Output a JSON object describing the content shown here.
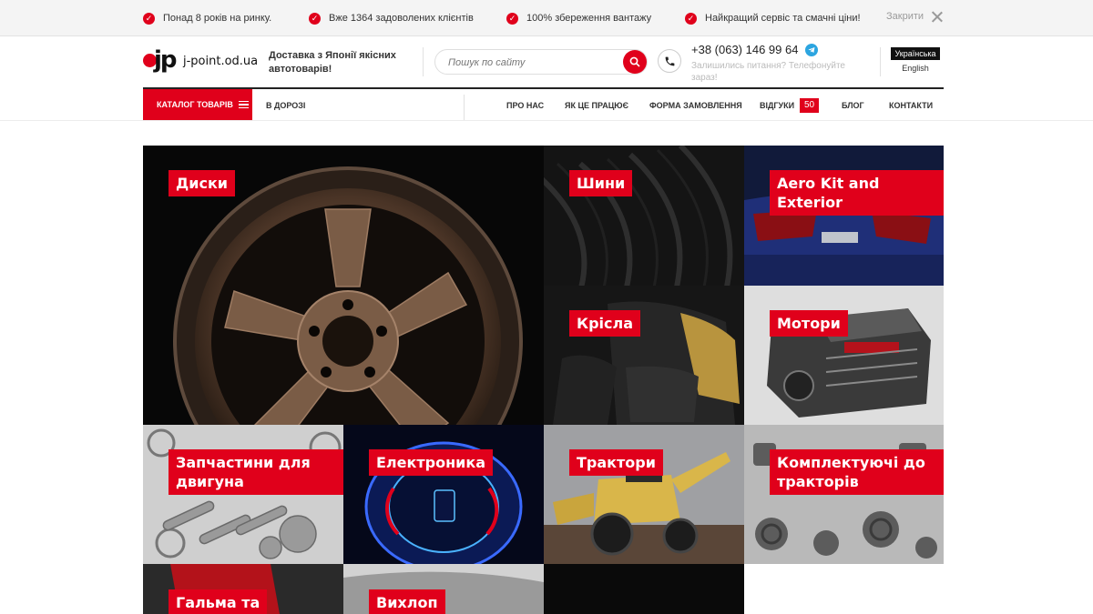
{
  "topbar": {
    "items": [
      {
        "text": "Понад 8 років на ринку."
      },
      {
        "text": "Вже 1364 задоволених клієнтів"
      },
      {
        "text": "100% збереження вантажу"
      },
      {
        "text": "Найкращий сервіс та смачні ціни!"
      }
    ],
    "close_label": "Закрити"
  },
  "header": {
    "logo_letters": "jp",
    "logo_text": "j-point.od.ua",
    "tagline": "Доставка з Японії якісних автотоварів!",
    "search_placeholder": "Пошук по сайту",
    "phone": "+38 (063) 146 99 64",
    "phone_sub": "Залишились питання? Телефонуйте зараз!",
    "lang_active": "Українська",
    "lang_other": "English"
  },
  "nav": {
    "catalog_label": "КАТАЛОГ ТОВАРІВ",
    "on_the_way": "В ДОРОЗІ",
    "links": [
      {
        "label": "ПРО НАС"
      },
      {
        "label": "ЯК ЦЕ ПРАЦЮЄ"
      },
      {
        "label": "ФОРМА ЗАМОВЛЕННЯ"
      },
      {
        "label": "ВІДГУКИ"
      },
      {
        "label": "БЛОГ"
      },
      {
        "label": "КОНТАКТИ"
      }
    ],
    "reviews_count": "50"
  },
  "categories": [
    {
      "label": "Диски"
    },
    {
      "label": "Шини"
    },
    {
      "label": "Aero Kit and Exterior"
    },
    {
      "label": "Крісла"
    },
    {
      "label": "Мотори"
    },
    {
      "label": "Запчастини для двигуна"
    },
    {
      "label": "Електроника"
    },
    {
      "label": "Трактори"
    },
    {
      "label": "Комплектуючі до тракторів"
    },
    {
      "label": "Гальма та"
    },
    {
      "label": "Вихлоп"
    }
  ],
  "colors": {
    "accent": "#e0001b",
    "nav_border": "#222222",
    "telegram": "#2ca5e0"
  },
  "icons": [
    "check-icon",
    "close-icon",
    "search-icon",
    "phone-icon",
    "telegram-icon",
    "menu-icon"
  ]
}
